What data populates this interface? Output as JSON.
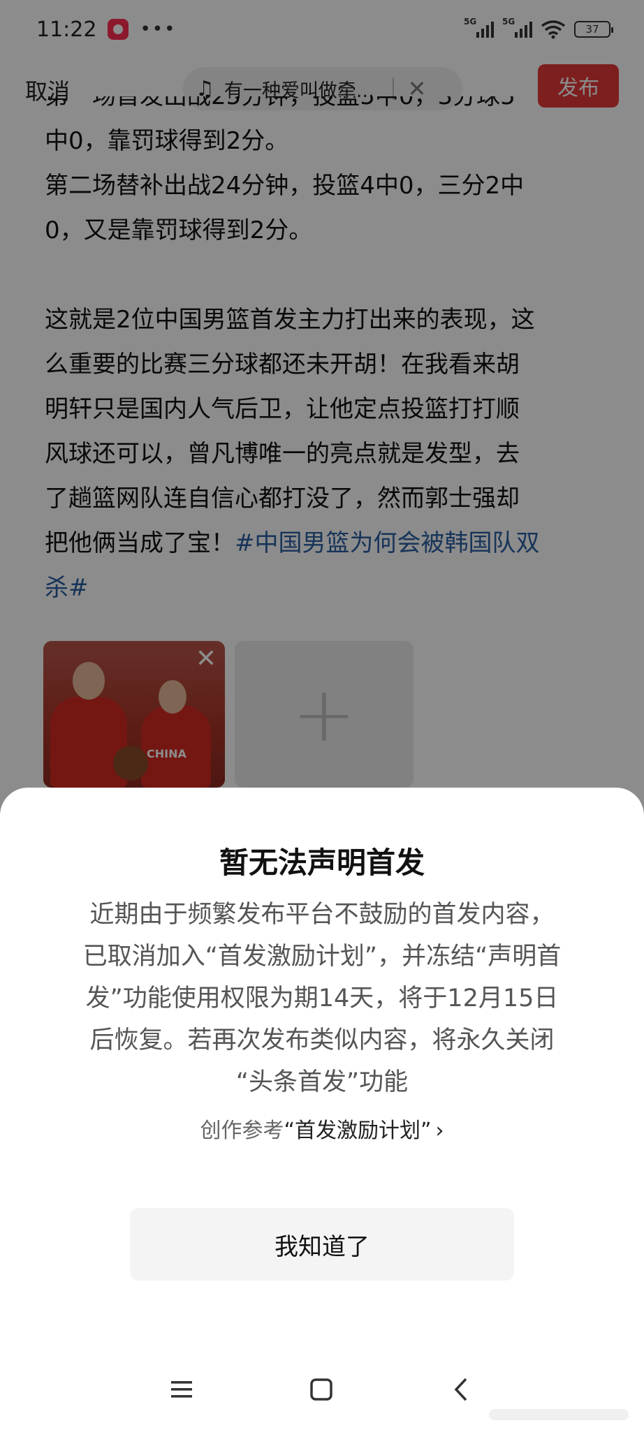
{
  "status_bar": {
    "time": "11:22",
    "dots": "•••",
    "network_1": "5G",
    "network_2": "5G",
    "battery": "37"
  },
  "top_bar": {
    "cancel_label": "取消",
    "music_title": "有一种爱叫做牵...",
    "publish_label": "发布"
  },
  "article": {
    "line_1": "第一场首发出战25分钟，投篮5中0，3分球5",
    "line_2": "中0，靠罚球得到2分。",
    "line_3": "第二场替补出战24分钟，投篮4中0，三分2中",
    "line_4": "0，又是靠罚球得到2分。",
    "line_5": "这就是2位中国男篮首发主力打出来的表现，这",
    "line_6": "么重要的比赛三分球都还未开胡！在我看来胡",
    "line_7": "明轩只是国内人气后卫，让他定点投篮打打顺",
    "line_8": "风球还可以，曾凡博唯一的亮点就是发型，去",
    "line_9": "了趟篮网队连自信心都打没了，然而郭士强却",
    "line_10_text": "把他俩当成了宝！",
    "line_10_hashtag": "#中国男篮为何会被韩国队双",
    "line_11_hashtag": "杀#"
  },
  "image": {
    "jersey_text": "CHINA"
  },
  "dialog": {
    "title": "暂无法声明首发",
    "message_line_1": "近期由于频繁发布平台不鼓励的首发内容，",
    "message_line_2": "已取消加入“首发激励计划”，并冻结“声明首",
    "message_line_3": "发”功能使用权限为期14天，将于12月15日",
    "message_line_4": "后恢复。若再次发布类似内容，将永久关闭",
    "message_line_5": "“头条首发”功能",
    "link_prefix": "创作参考",
    "link_text": "“首发激励计划”",
    "button_label": "我知道了"
  },
  "colors": {
    "publish_button": "#e43a3a",
    "hashtag": "#2b5fa3",
    "overlay": "rgba(0,0,0,0.45)"
  },
  "icons": [
    "app-badge-icon",
    "more-dots-icon",
    "signal-icon",
    "wifi-icon",
    "battery-icon",
    "music-note-icon",
    "close-icon",
    "plus-icon",
    "menu-icon",
    "home-icon",
    "back-icon",
    "chevron-right-icon"
  ]
}
